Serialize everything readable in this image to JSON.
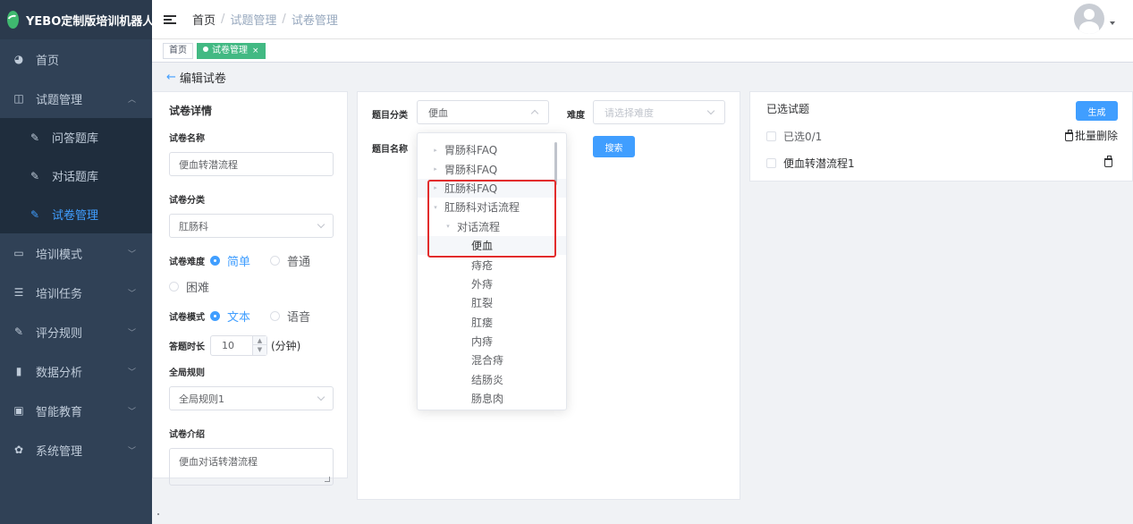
{
  "brand": {
    "title": "YEBO定制版培训机器人"
  },
  "sidebar": {
    "items": [
      {
        "label": "首页",
        "icon": "dashboard-icon"
      },
      {
        "label": "试题管理",
        "icon": "book-icon",
        "expanded": true,
        "children": [
          {
            "label": "问答题库",
            "icon": "edit-icon"
          },
          {
            "label": "对话题库",
            "icon": "edit-icon"
          },
          {
            "label": "试卷管理",
            "icon": "edit-icon",
            "active": true
          }
        ]
      },
      {
        "label": "培训模式",
        "icon": "monitor-icon"
      },
      {
        "label": "培训任务",
        "icon": "list-icon"
      },
      {
        "label": "评分规则",
        "icon": "edit-icon"
      },
      {
        "label": "数据分析",
        "icon": "bar-chart-icon"
      },
      {
        "label": "智能教育",
        "icon": "screen-icon"
      },
      {
        "label": "系统管理",
        "icon": "gear-icon"
      }
    ]
  },
  "header": {
    "breadcrumb": [
      "首页",
      "试题管理",
      "试卷管理"
    ]
  },
  "tags": [
    {
      "label": "首页",
      "active": false
    },
    {
      "label": "试卷管理",
      "active": true,
      "close": "×"
    }
  ],
  "page": {
    "back_label": "编辑试卷"
  },
  "form": {
    "section_title": "试卷详情",
    "name_label": "试卷名称",
    "name_value": "便血转潜流程",
    "category_label": "试卷分类",
    "category_value": "肛肠科",
    "difficulty_label": "试卷难度",
    "difficulty_options": [
      "简单",
      "普通",
      "困难"
    ],
    "difficulty_selected": "简单",
    "mode_label": "试卷模式",
    "mode_options": [
      "文本",
      "语音"
    ],
    "mode_selected": "文本",
    "duration_label": "答题时长",
    "duration_value": "10",
    "duration_unit": "(分钟)",
    "rule_label": "全局规则",
    "rule_value": "全局规则1",
    "intro_label": "试卷介绍",
    "intro_value": "便血对话转潜流程"
  },
  "filters": {
    "category_label": "题目分类",
    "category_value": "便血",
    "difficulty_label": "难度",
    "difficulty_placeholder": "请选择难度",
    "name_label": "题目名称",
    "search_label": "搜索"
  },
  "dropdown": {
    "items": [
      {
        "label": "胃肠科FAQ",
        "level": 0,
        "arrow": "▸"
      },
      {
        "label": "胃肠科FAQ",
        "level": 0,
        "arrow": "▸"
      },
      {
        "label": "肛肠科FAQ",
        "level": 0,
        "arrow": "▸"
      },
      {
        "label": "肛肠科对话流程",
        "level": 0,
        "arrow": "▾"
      },
      {
        "label": "对话流程",
        "level": 1,
        "arrow": "▾"
      },
      {
        "label": "便血",
        "level": 2,
        "selected": true
      },
      {
        "label": "痔疮",
        "level": 2
      },
      {
        "label": "外痔",
        "level": 2
      },
      {
        "label": "肛裂",
        "level": 2
      },
      {
        "label": "肛瘘",
        "level": 2
      },
      {
        "label": "内痔",
        "level": 2
      },
      {
        "label": "混合痔",
        "level": 2
      },
      {
        "label": "结肠炎",
        "level": 2
      },
      {
        "label": "肠息肉",
        "level": 2
      }
    ]
  },
  "selected_panel": {
    "title": "已选试题",
    "generate_label": "生成",
    "count_label": "已选0/1",
    "batch_delete_label": "批量删除",
    "items": [
      {
        "label": "便血转潜流程1"
      }
    ]
  },
  "colors": {
    "primary": "#409eff",
    "sidebar_bg": "#304156",
    "tag_active": "#42b983",
    "highlight_box": "#e22c2c"
  }
}
